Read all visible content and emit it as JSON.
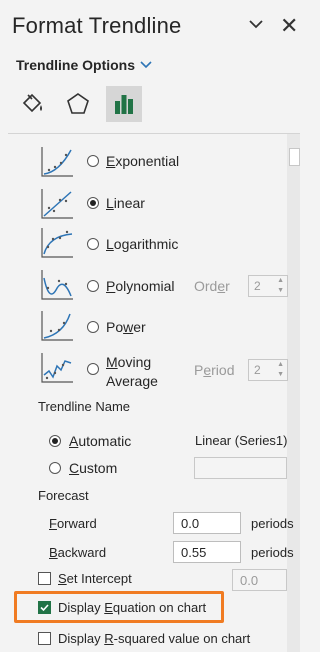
{
  "pane": {
    "title": "Format Trendline",
    "subtitle": "Trendline Options",
    "tabs": [
      "fill-line-icon",
      "effects-icon",
      "trendline-options-icon"
    ]
  },
  "types": {
    "exponential_pre": "",
    "exponential_u": "E",
    "exponential_post": "xponential",
    "linear_pre": "",
    "linear_u": "L",
    "linear_post": "inear",
    "log_pre": "",
    "log_u": "L",
    "log_post": "ogarithmic",
    "poly_pre": "",
    "poly_u": "P",
    "poly_post": "olynomial",
    "power_pre": "Po",
    "power_u": "w",
    "power_post": "er",
    "moving_pre": "",
    "moving_u": "M",
    "moving_post": "oving",
    "moving_line2": "Average",
    "order_pre": "Ord",
    "order_u": "e",
    "order_post": "r",
    "order_value": "2",
    "period_pre": "P",
    "period_u": "e",
    "period_post": "riod",
    "period_value": "2",
    "selected": "Linear"
  },
  "name": {
    "heading": "Trendline Name",
    "automatic_pre": "",
    "automatic_u": "A",
    "automatic_post": "utomatic",
    "automatic_value": "Linear (Series1)",
    "custom_pre": "",
    "custom_u": "C",
    "custom_post": "ustom",
    "custom_value": ""
  },
  "forecast": {
    "heading": "Forecast",
    "forward_pre": "",
    "forward_u": "F",
    "forward_post": "orward",
    "forward_value": "0.0",
    "backward_pre": "",
    "backward_u": "B",
    "backward_post": "ackward",
    "backward_value": "0.55",
    "unit": "periods"
  },
  "options": {
    "intercept_pre": "",
    "intercept_u": "S",
    "intercept_post": "et Intercept",
    "intercept_value": "0.0",
    "intercept_checked": false,
    "equation_pre": "Display ",
    "equation_u": "E",
    "equation_post": "quation on chart",
    "equation_checked": true,
    "rsquared_pre": "Display ",
    "rsquared_u": "R",
    "rsquared_post": "-squared value on chart",
    "rsquared_checked": false
  },
  "colors": {
    "accent": "#217346",
    "highlight": "#f07b22"
  }
}
